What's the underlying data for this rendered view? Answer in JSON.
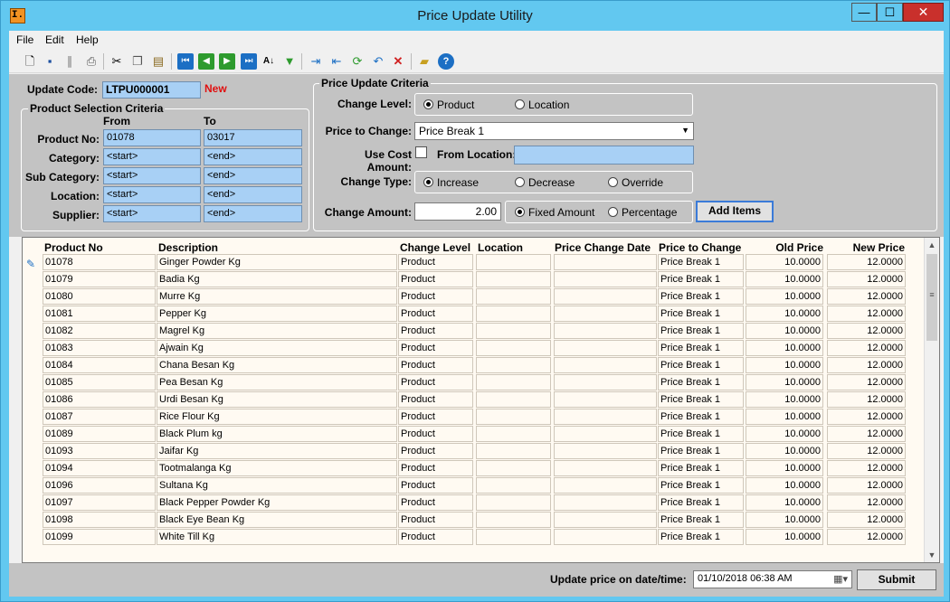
{
  "window": {
    "title": "Price Update Utility",
    "app_icon_text": "I.",
    "min_glyph": "—",
    "max_glyph": "☐",
    "close_glyph": "✕"
  },
  "menu": [
    "File",
    "Edit",
    "Help"
  ],
  "update_code": {
    "label": "Update Code:",
    "value": "LTPU000001",
    "status": "New"
  },
  "product_selection": {
    "title": "Product Selection Criteria",
    "from_header": "From",
    "to_header": "To",
    "rows": [
      {
        "label": "Product No:",
        "from": "01078",
        "to": "03017"
      },
      {
        "label": "Category:",
        "from": "<start>",
        "to": "<end>"
      },
      {
        "label": "Sub Category:",
        "from": "<start>",
        "to": "<end>"
      },
      {
        "label": "Location:",
        "from": "<start>",
        "to": "<end>"
      },
      {
        "label": "Supplier:",
        "from": "<start>",
        "to": "<end>"
      }
    ]
  },
  "price_update": {
    "title": "Price Update Criteria",
    "change_level": {
      "label": "Change Level:",
      "options": [
        "Product",
        "Location"
      ],
      "selected": "Product"
    },
    "price_to_change": {
      "label": "Price to Change:",
      "value": "Price Break 1"
    },
    "use_cost": {
      "label": "Use Cost Amount:",
      "checked": false
    },
    "from_location": {
      "label": "From Location:",
      "value": ""
    },
    "change_type": {
      "label": "Change Type:",
      "options": [
        "Increase",
        "Decrease",
        "Override"
      ],
      "selected": "Increase"
    },
    "change_amount": {
      "label": "Change Amount:",
      "value": "2.00",
      "modes": [
        "Fixed Amount",
        "Percentage"
      ],
      "selected": "Fixed Amount"
    },
    "add_items_label": "Add Items"
  },
  "grid": {
    "headers": [
      "Product No",
      "Description",
      "Change Level",
      "Location",
      "Price Change Date",
      "Price to Change",
      "Old Price",
      "New Price"
    ],
    "rows": [
      [
        "01078",
        " Ginger Powder Kg",
        "Product",
        "",
        "",
        "Price Break 1",
        "10.0000",
        "12.0000"
      ],
      [
        "01079",
        "Badia Kg",
        "Product",
        "",
        "",
        "Price Break 1",
        "10.0000",
        "12.0000"
      ],
      [
        "01080",
        "Murre Kg",
        "Product",
        "",
        "",
        "Price Break 1",
        "10.0000",
        "12.0000"
      ],
      [
        "01081",
        "Pepper Kg",
        "Product",
        "",
        "",
        "Price Break 1",
        "10.0000",
        "12.0000"
      ],
      [
        "01082",
        "Magrel Kg",
        "Product",
        "",
        "",
        "Price Break 1",
        "10.0000",
        "12.0000"
      ],
      [
        "01083",
        "Ajwain Kg",
        "Product",
        "",
        "",
        "Price Break 1",
        "10.0000",
        "12.0000"
      ],
      [
        "01084",
        "Chana Besan Kg",
        "Product",
        "",
        "",
        "Price Break 1",
        "10.0000",
        "12.0000"
      ],
      [
        "01085",
        "Pea Besan Kg",
        "Product",
        "",
        "",
        "Price Break 1",
        "10.0000",
        "12.0000"
      ],
      [
        "01086",
        "Urdi Besan Kg",
        "Product",
        "",
        "",
        "Price Break 1",
        "10.0000",
        "12.0000"
      ],
      [
        "01087",
        "Rice Flour Kg",
        "Product",
        "",
        "",
        "Price Break 1",
        "10.0000",
        "12.0000"
      ],
      [
        "01089",
        "Black Plum kg",
        "Product",
        "",
        "",
        "Price Break 1",
        "10.0000",
        "12.0000"
      ],
      [
        "01093",
        "Jaifar Kg",
        "Product",
        "",
        "",
        "Price Break 1",
        "10.0000",
        "12.0000"
      ],
      [
        "01094",
        "Tootmalanga Kg",
        "Product",
        "",
        "",
        "Price Break 1",
        "10.0000",
        "12.0000"
      ],
      [
        "01096",
        "Sultana Kg",
        "Product",
        "",
        "",
        "Price Break 1",
        "10.0000",
        "12.0000"
      ],
      [
        "01097",
        "Black Pepper Powder Kg",
        "Product",
        "",
        "",
        "Price Break 1",
        "10.0000",
        "12.0000"
      ],
      [
        "01098",
        "Black Eye Bean Kg",
        "Product",
        "",
        "",
        "Price Break 1",
        "10.0000",
        "12.0000"
      ],
      [
        "01099",
        "White Till Kg",
        "Product",
        "",
        "",
        "Price Break 1",
        "10.0000",
        "12.0000"
      ]
    ]
  },
  "footer": {
    "label": "Update price on date/time:",
    "datetime": "01/10/2018 06:38 AM",
    "submit_label": "Submit"
  },
  "colors": {
    "status_new": "#e01010",
    "field_blue": "#a8d0f5",
    "window_frame": "#62c8f0"
  }
}
